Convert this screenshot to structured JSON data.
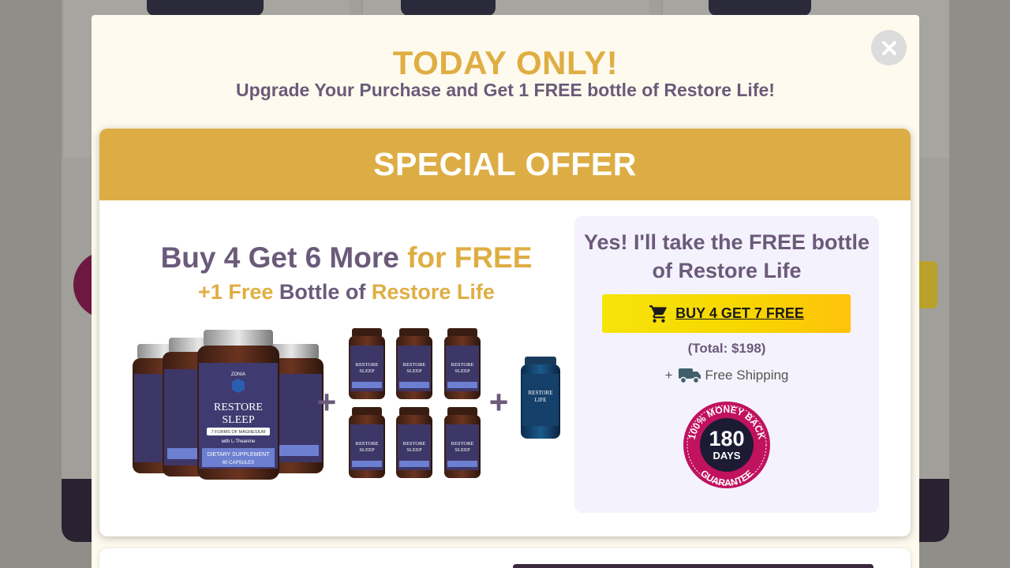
{
  "modal": {
    "title": "TODAY ONLY!",
    "subtitle": "Upgrade Your Purchase and Get 1 FREE bottle of Restore Life!",
    "close_icon": "close-icon"
  },
  "offer": {
    "banner": "SPECIAL OFFER",
    "headline_main": "Buy 4 Get 6 More",
    "headline_accent": "for FREE",
    "subline_plus": "+1 Free",
    "subline_mid": "Bottle of",
    "subline_product": "Restore Life",
    "product_image": {
      "brand": "ZONIA",
      "main_line1": "RESTORE",
      "main_line2": "SLEEP",
      "main_feature": "7 FORMS OF MAGNESIUM",
      "main_with": "with L-Theanine",
      "main_supplement": "DIETARY SUPPLEMENT",
      "main_capsules": "60 CAPSULES",
      "plus": "+",
      "life_line1": "RESTORE",
      "life_line2": "LIFE"
    }
  },
  "cta": {
    "title": "Yes! I'll take the FREE bottle of Restore Life",
    "button_label": "BUY 4 GET 7 FREE",
    "button_icon": "cart-icon",
    "total": "(Total: $198)",
    "shipping_prefix": "+",
    "shipping_icon": "truck-icon",
    "shipping_text": "Free Shipping"
  },
  "guarantee": {
    "top_text": "100% MONEY BACK",
    "number": "180",
    "unit": "DAYS",
    "bottom_text": "GUARANTEE"
  },
  "colors": {
    "gold": "#dfae43",
    "purple_text": "#6b5a7a",
    "banner": "#ddad45",
    "cta_yellow": "#f8d700",
    "badge_magenta": "#c0125e",
    "badge_navy": "#1c1b33"
  }
}
